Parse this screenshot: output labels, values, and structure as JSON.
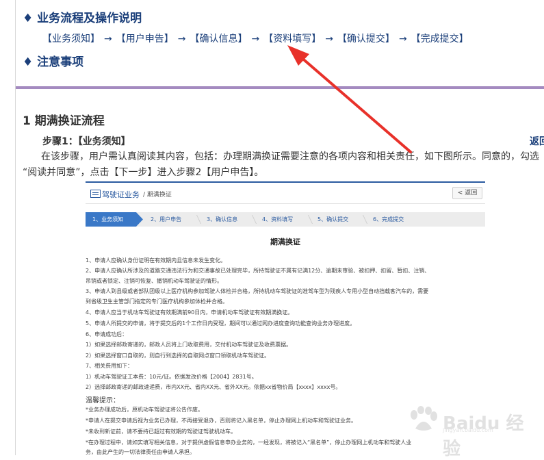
{
  "heading_flow": "♦ 业务流程及操作说明",
  "flow_steps": [
    "【业务须知】",
    "【用户申告】",
    "【确认信息】",
    "【资料填写】",
    "【确认提交】",
    "【完成提交】"
  ],
  "flow_arrow": "→",
  "heading_notes": "♦ 注意事项",
  "section_title": "1 期满换证流程",
  "step1_title": "步骤1：【业务须知】",
  "back_link": "返回",
  "paragraph_line1": "在该步骤，用户需认真阅读其内容，包括：办理期满换证需要注意的各项内容和相关责任，如下图所示。同意的，勾选",
  "paragraph_line2": "“阅读并同意”，点击【下一步】进入步骤2【用户申告】。",
  "screenshot": {
    "breadcrumb_main": "驾驶证业务",
    "breadcrumb_sub": "/ 期满换证",
    "back_button": "< 返回",
    "steps": [
      "1、业务须知",
      "2、用户申告",
      "3、确认信息",
      "4、资料填写",
      "5、确认提交",
      "6、完成提交"
    ],
    "title": "期满换证",
    "rules": [
      "1、申请人应确认身份证明在有效期内且信息未发生变化。",
      "2、申请人应确认所涉及的道路交通违法行为和交通事故已处理完毕，所持驾驶证不属有记满12分、逾期未审验、被扣押、扣留、暂扣、注销、",
      "吊销或者锁定、注销可恢复、撤销机动车驾驶证的情形。",
      "3、申请人到县级或者部队团级以上医疗机构参加驾驶人体检并合格，所持机动车驾驶证的准驾车型为残疾人专用小型自动挡载客汽车的，需要",
      "到省级卫生主管部门指定的专门医疗机构参加体检并合格。",
      "4、申请人应当于机动车驾驶证有效期满前90日内，申请机动车驾驶证有效期满换证。",
      "5、申请人所提交的申请，将于提交后的1个工作日内受理，期间可以通过网办进度查询功能查询业务办理进度。",
      "6、申请成功后：",
      "1）如果选择邮政寄递的，邮政人员将上门收取费用，交付机动车驾驶证及收费票据。",
      "2）如果选择窗口自取的，则自行到选择的自取网点窗口领取机动车驾驶证。",
      "7、相关费用如下：",
      "1）机动车驾驶证工本费：10元/证。依据发改价格【2004】2831号。",
      "2）选择邮政寄递的邮政速递费，市内XX元、省内XX元、省外XX元。依据xx省物价局【xxxx】xxxx号。"
    ],
    "tips_title": "温馨提示：",
    "tips": [
      "*业务办理成功后，原机动车驾驶证将公告作废。",
      "*申请人在提交申请后视为业务已办理，不再接受退办，否则将记入黑名单，停止办理网上机动车和驾驶证业务。",
      "*未收到新证前，请不要持已超过有效期的驾驶证驾驶机动车。",
      "*在办理过程中，请如实填写相关信息，对于提供虚假信息申办业务的，一经发现，将被记入“黑名单”，停止办理网上机动车和驾驶人业",
      "务，由此产生的一切法律责任由申请人承担。"
    ]
  },
  "watermark": {
    "text": "Baidu 经验",
    "sub": "jingyan.baidu.com"
  },
  "colors": {
    "heading_blue": "#1b3f7a",
    "divider_purple": "#a48ac0",
    "arrow_red": "#e8312a",
    "step_active": "#3a78c7"
  }
}
